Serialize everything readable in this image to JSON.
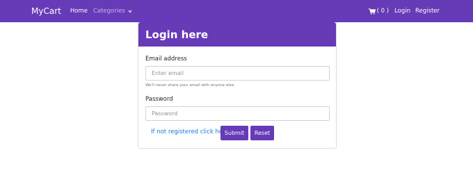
{
  "navbar": {
    "brand": "MyCart",
    "home": "Home",
    "categories": "Categories",
    "cart_label": "( 0 )",
    "login": "Login",
    "register": "Register"
  },
  "card": {
    "title": "Login here",
    "email": {
      "label": "Email address",
      "placeholder": "Enter email",
      "value": "",
      "help": "We'll never share your email with anyone else."
    },
    "password": {
      "label": "Password",
      "placeholder": "Password",
      "value": ""
    },
    "register_link": "If not registered click here",
    "submit_label": "Submit",
    "reset_label": "Reset"
  },
  "colors": {
    "primary": "#673ab7",
    "link": "#1a78d6"
  },
  "icons": {
    "cart": "shopping-cart-icon",
    "dropdown": "caret-down-icon"
  }
}
